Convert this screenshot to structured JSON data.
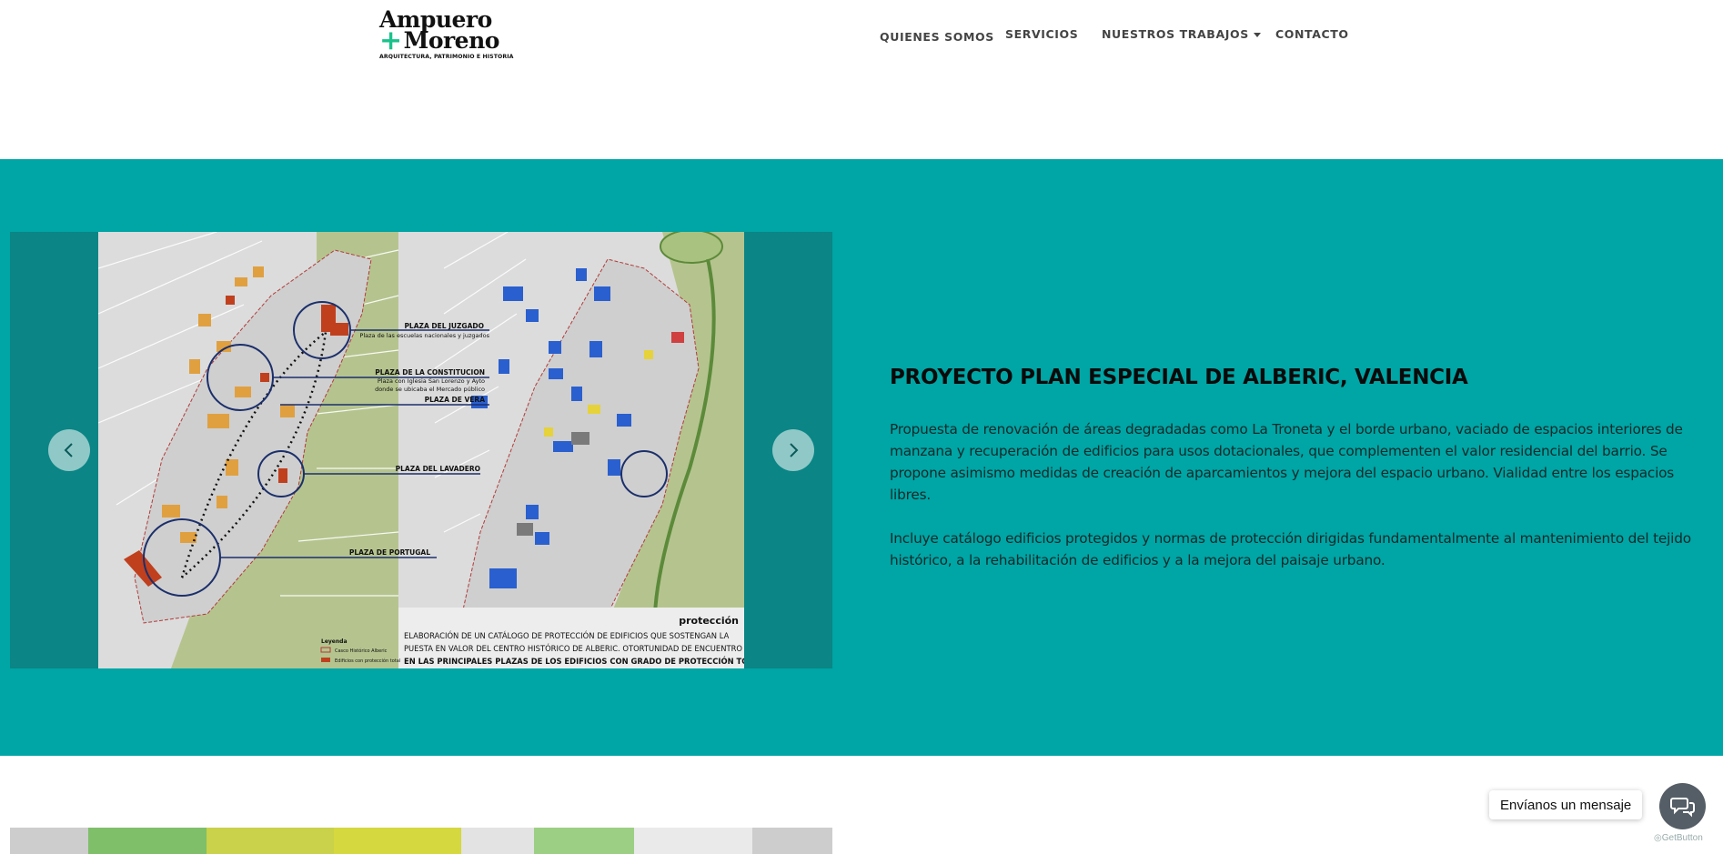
{
  "header": {
    "logo": {
      "line1": "Ampuero",
      "plus": "+",
      "line2": "Moreno",
      "tagline": "ARQUITECTURA, PATRIMONIO E HISTORIA"
    },
    "nav": [
      {
        "label": "QUIENES SOMOS"
      },
      {
        "label": "SERVICIOS"
      },
      {
        "label": "NUESTROS TRABAJOS",
        "has_dropdown": true
      },
      {
        "label": "CONTACTO"
      }
    ]
  },
  "project": {
    "title": "PROYECTO PLAN ESPECIAL DE ALBERIC, VALENCIA",
    "paragraph1": "Propuesta de renovación de áreas degradadas como La Troneta y el borde urbano, vaciado de espacios interiores de manzana y recuperación de edificios para usos dotacionales, que complementen el valor residencial del barrio. Se propone asimismo medidas de creación de aparcamientos y mejora del espacio urbano. Vialidad entre los espacios libres.",
    "paragraph2": "Incluye catálogo edificios protegidos y normas de protección dirigidas fundamentalmente al mantenimiento del tejido histórico, a la rehabilitación de edificios y a la mejora del paisaje urbano."
  },
  "slide": {
    "labels": {
      "juzgado": "PLAZA DEL JUZGADO",
      "juzgado_sub": "Plaza de las escuelas nacionales y juzgados",
      "constitucion": "PLAZA DE LA CONSTITUCION",
      "constitucion_sub1": "Plaza con Iglesia San Lorenzo y Ayto",
      "constitucion_sub2": "donde se ubicaba el Mercado público",
      "vera": "PLAZA DE VERA",
      "lavadero": "PLAZA DEL LAVADERO",
      "portugal": "PLAZA DE PORTUGAL",
      "proteccion": "protección",
      "caption1": "ELABORACIÓN DE UN CATÁLOGO DE PROTECCIÓN DE EDIFICIOS QUE SOSTENGAN LA",
      "caption2": "PUESTA EN VALOR DEL CENTRO HISTÓRICO DE ALBERIC. OTORTUNIDAD DE ENCUENTRO",
      "caption3": "EN LAS PRINCIPALES PLAZAS DE LOS EDIFICIOS CON  GRADO DE PROTECCIÓN TOTAL .",
      "leyenda": "Leyenda",
      "legend1": "Casco Histórico Alberic",
      "legend2": "Edificios con protección total"
    }
  },
  "chat": {
    "bubble": "Envíanos un mensaje",
    "powered": "GetButton"
  },
  "colors": {
    "teal": "#00a5a5",
    "carousel_bg": "#0b8585",
    "logo_accent": "#19c28a"
  }
}
